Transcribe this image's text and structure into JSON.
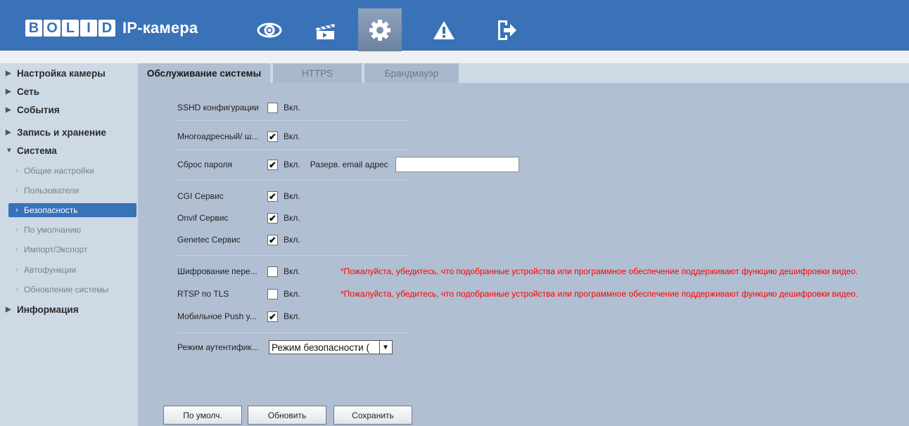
{
  "app": {
    "brand": [
      "B",
      "O",
      "L",
      "I",
      "D"
    ],
    "title": "IP-камера"
  },
  "nav": {
    "icons": [
      "eye-icon",
      "clapperboard-icon",
      "gear-icon",
      "warning-icon",
      "logout-icon"
    ],
    "active": "gear-icon"
  },
  "sidebar": {
    "groups": {
      "camera": "Настройка камеры",
      "network": "Сеть",
      "events": "События",
      "storage": "Запись и хранение",
      "system": "Система",
      "info": "Информация"
    },
    "system_items": {
      "general": "Общие настройки",
      "users": "Пользователи",
      "security": "Безопасность",
      "defaults": "По умолчанию",
      "import_export": "Импорт/Экспорт",
      "auto": "Автофункции",
      "update": "Обновление системы"
    }
  },
  "tabs": {
    "maintenance": "Обслуживание системы",
    "https": "HTTPS",
    "firewall": "Брандмауэр"
  },
  "form": {
    "on_label": "Вкл.",
    "sshd": {
      "label": "SSHD конфигурации",
      "checked": false
    },
    "multicast": {
      "label": "Многоадресный/ ш...",
      "checked": true
    },
    "password_reset": {
      "label": "Сброс пароля",
      "checked": true,
      "email_label": "Разерв. email адрес",
      "email_value": ""
    },
    "cgi": {
      "label": "CGI Сервис",
      "checked": true
    },
    "onvif": {
      "label": "Onvif Сервис",
      "checked": true
    },
    "genetec": {
      "label": "Genetec Сервис",
      "checked": true
    },
    "encryption": {
      "label": "Шифрование пере...",
      "checked": false
    },
    "rtsp_tls": {
      "label": "RTSP по TLS",
      "checked": false
    },
    "mobile_push": {
      "label": "Мобильное Push у...",
      "checked": true
    },
    "warning": "*Пожалуйста, убедитесь, что подобранные устройства или программное обеспечение поддерживают функцию дешифровки видео.",
    "auth_mode": {
      "label": "Режим аутентифик...",
      "value": "Режим безопасности (",
      "options": [
        "Режим безопасности ("
      ]
    }
  },
  "buttons": {
    "default": "По умолч.",
    "refresh": "Обновить",
    "save": "Сохранить"
  },
  "colors": {
    "header": "#3a72b8",
    "sidebar": "#ced9e6",
    "content": "#b1bfd2",
    "active_item": "#3a72b8",
    "warning": "#ff0000"
  }
}
